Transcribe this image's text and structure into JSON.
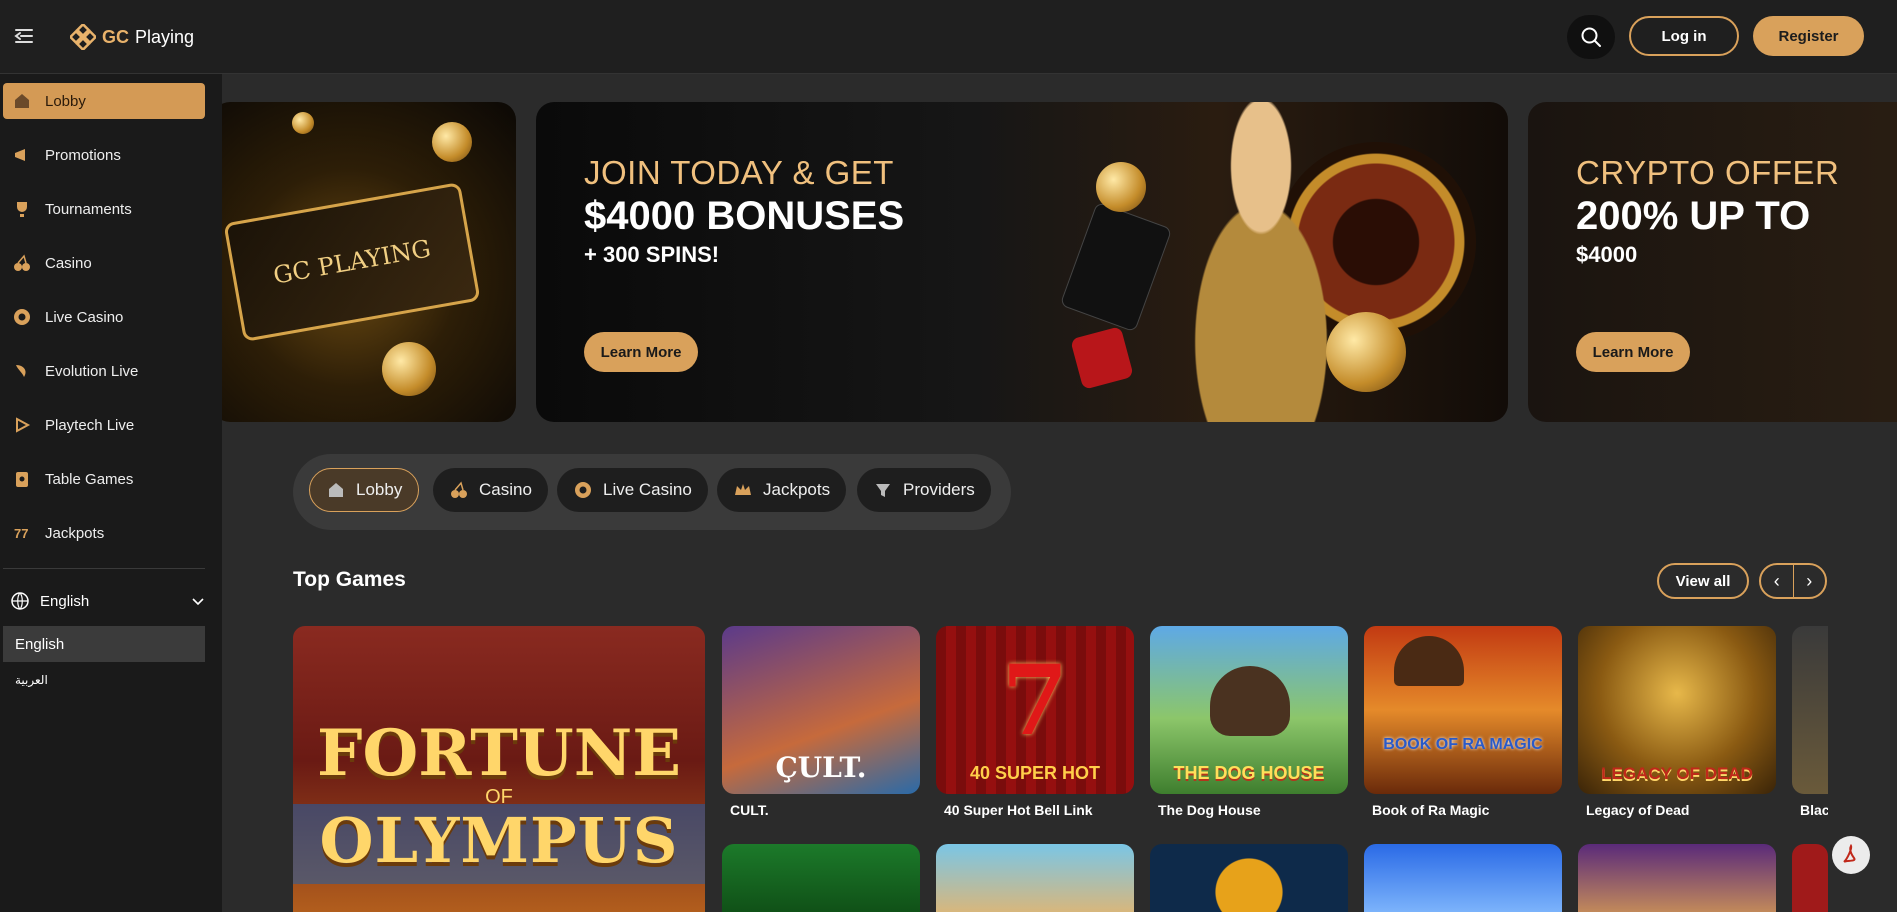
{
  "header": {
    "logo_text_a": "GC",
    "logo_text_b": "Playing",
    "login_label": "Log in",
    "register_label": "Register"
  },
  "sidebar": {
    "items": [
      {
        "label": "Lobby",
        "icon": "lobby-icon",
        "active": true
      },
      {
        "label": "Promotions",
        "icon": "promotions-icon"
      },
      {
        "label": "Tournaments",
        "icon": "trophy-icon"
      },
      {
        "label": "Casino",
        "icon": "cherry-icon"
      },
      {
        "label": "Live Casino",
        "icon": "chip-icon"
      },
      {
        "label": "Evolution Live",
        "icon": "evolution-icon"
      },
      {
        "label": "Playtech Live",
        "icon": "playtech-icon"
      },
      {
        "label": "Table Games",
        "icon": "cards-icon"
      },
      {
        "label": "Jackpots",
        "icon": "jackpot-icon"
      }
    ],
    "language": {
      "current": "English",
      "options": [
        "English",
        "العربية"
      ]
    }
  },
  "banners": [
    {
      "card_text": "GC PLAYING"
    },
    {
      "line1": "JOIN TODAY & GET",
      "line2": "$4000 BONUSES",
      "line3": "+ 300 SPINS!",
      "button": "Learn More"
    },
    {
      "line1": "CRYPTO OFFER",
      "line2": "200% UP TO",
      "line3": "$4000",
      "button": "Learn More"
    }
  ],
  "categories": [
    {
      "label": "Lobby",
      "active": true
    },
    {
      "label": "Casino"
    },
    {
      "label": "Live Casino"
    },
    {
      "label": "Jackpots"
    },
    {
      "label": "Providers"
    }
  ],
  "top_games": {
    "title": "Top Games",
    "view_all": "View all",
    "featured": {
      "line1": "FORTUNE",
      "line2": "OF",
      "line3": "OLYMPUS"
    },
    "games": [
      {
        "name": "CULT.",
        "art": "ÇULT."
      },
      {
        "name": "40 Super Hot Bell Link",
        "art": "40 SUPER HOT"
      },
      {
        "name": "The Dog House",
        "art": "THE DOG HOUSE"
      },
      {
        "name": "Book of Ra Magic",
        "art": "BOOK OF RA MAGIC"
      },
      {
        "name": "Legacy of Dead",
        "art": "LEGACY OF DEAD"
      },
      {
        "name": "Blac"
      }
    ]
  },
  "colors": {
    "accent": "#d9a15b",
    "background": "#2b2b2b",
    "sidebar": "#1a1a1a"
  }
}
